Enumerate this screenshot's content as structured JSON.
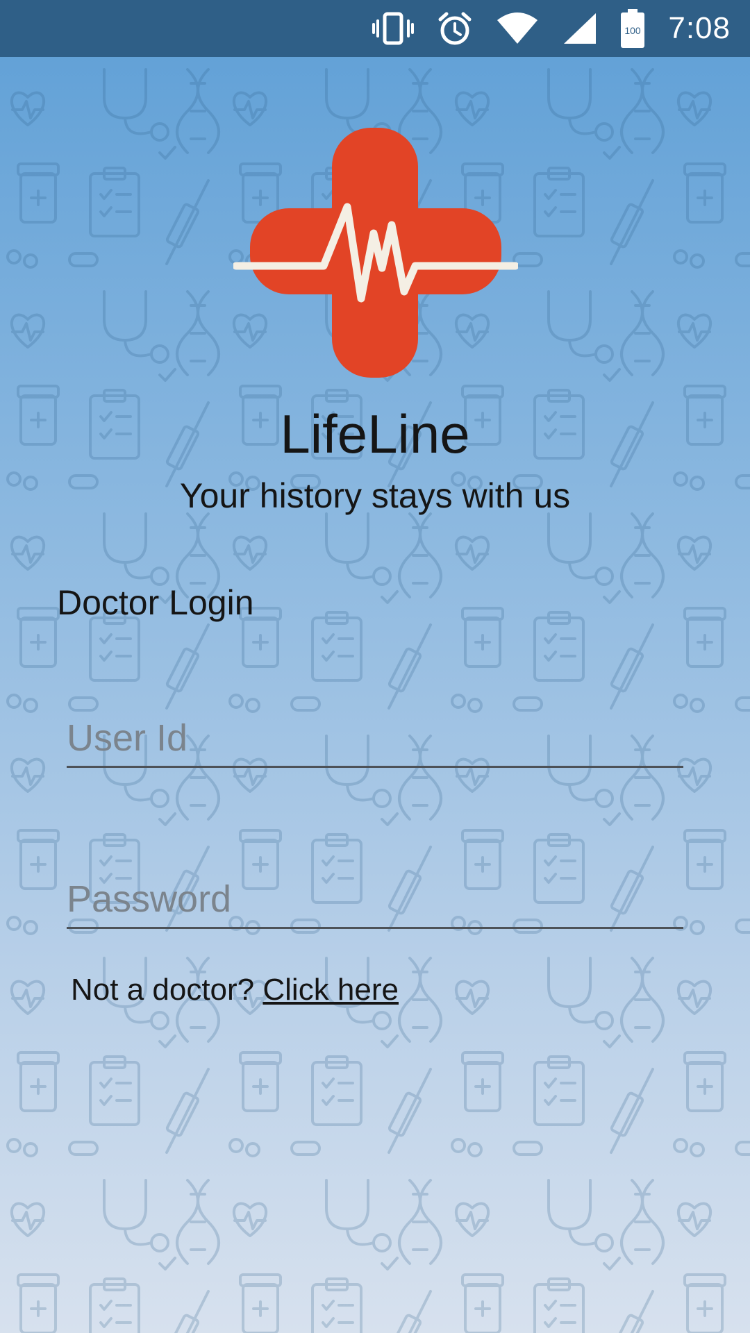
{
  "status_bar": {
    "time": "7:08",
    "battery_level": "100",
    "icons": [
      "vibrate-icon",
      "alarm-icon",
      "wifi-icon",
      "signal-icon",
      "battery-icon"
    ]
  },
  "app": {
    "name": "LifeLine",
    "tagline": "Your history stays with us",
    "logo_icon": "medical-cross-heartbeat-icon"
  },
  "login": {
    "title": "Doctor Login",
    "user_id_placeholder": "User Id",
    "password_placeholder": "Password",
    "alt_prompt": "Not a doctor? ",
    "alt_link": "Click here"
  },
  "colors": {
    "status_bar": "#2f5f87",
    "logo_cross": "#e24426",
    "logo_pulse": "#f4efe4",
    "background_top": "#5e9fd6",
    "background_bottom": "#d7e1ee"
  }
}
